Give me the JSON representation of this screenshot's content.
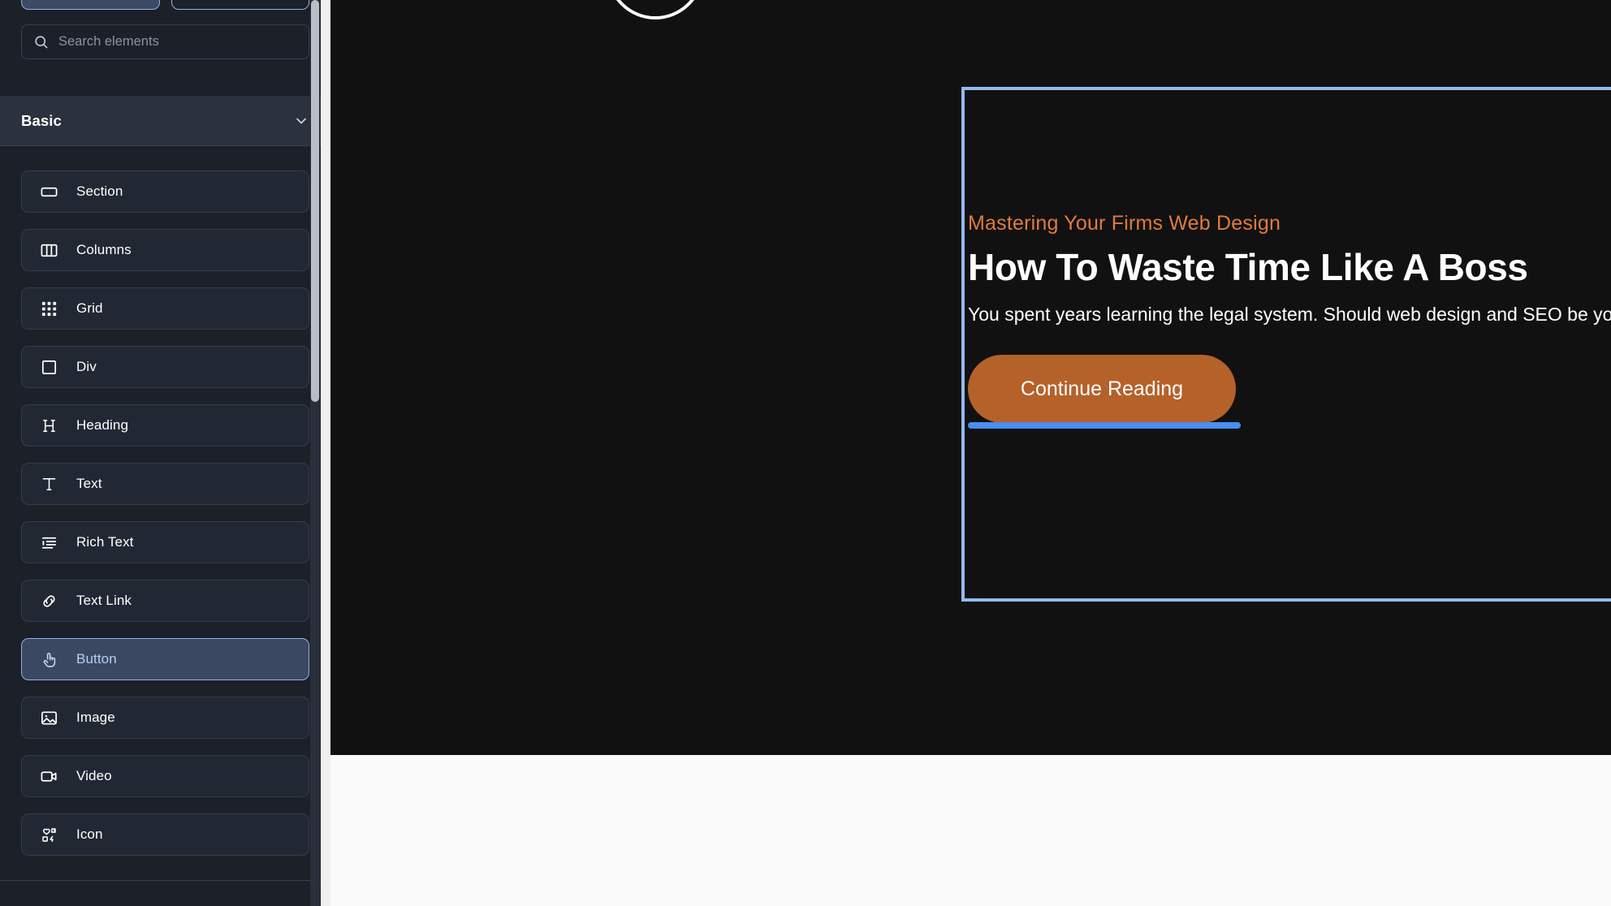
{
  "sidebar": {
    "tabs": [
      {
        "label": "",
        "name": "tab-elements",
        "state": "active"
      },
      {
        "label": "",
        "name": "tab-layers",
        "state": "inactive"
      }
    ],
    "search": {
      "placeholder": "Search elements",
      "value": "",
      "icon": "search-icon"
    },
    "group": {
      "title": "Basic",
      "collapse_icon": "chevron-down-icon"
    },
    "elements": [
      {
        "label": "Section",
        "icon": "section-icon",
        "selected": false
      },
      {
        "label": "Columns",
        "icon": "columns-icon",
        "selected": false
      },
      {
        "label": "Grid",
        "icon": "grid-icon",
        "selected": false
      },
      {
        "label": "Div",
        "icon": "div-icon",
        "selected": false
      },
      {
        "label": "Heading",
        "icon": "heading-icon",
        "selected": false
      },
      {
        "label": "Text",
        "icon": "text-icon",
        "selected": false
      },
      {
        "label": "Rich Text",
        "icon": "rich-text-icon",
        "selected": false
      },
      {
        "label": "Text Link",
        "icon": "link-icon",
        "selected": false
      },
      {
        "label": "Button",
        "icon": "pointer-hand-icon",
        "selected": true
      },
      {
        "label": "Image",
        "icon": "image-icon",
        "selected": false
      },
      {
        "label": "Video",
        "icon": "video-icon",
        "selected": false
      },
      {
        "label": "Icon",
        "icon": "sticker-icon",
        "selected": false
      }
    ]
  },
  "canvas": {
    "hero": {
      "eyebrow": "Mastering Your Firms Web Design",
      "title": "How To Waste Time Like A Boss",
      "subtitle": "You spent years learning the legal system. Should web design and SEO be your next skill?",
      "cta_label": "Continue Reading"
    }
  },
  "colors": {
    "accent_orange": "#e07b3c",
    "cta_background": "#b5612a",
    "selection_blue": "#92bbf0",
    "drop_indicator_blue": "#4a8df0",
    "panel_background": "#1b2029",
    "canvas_background": "#111111"
  }
}
